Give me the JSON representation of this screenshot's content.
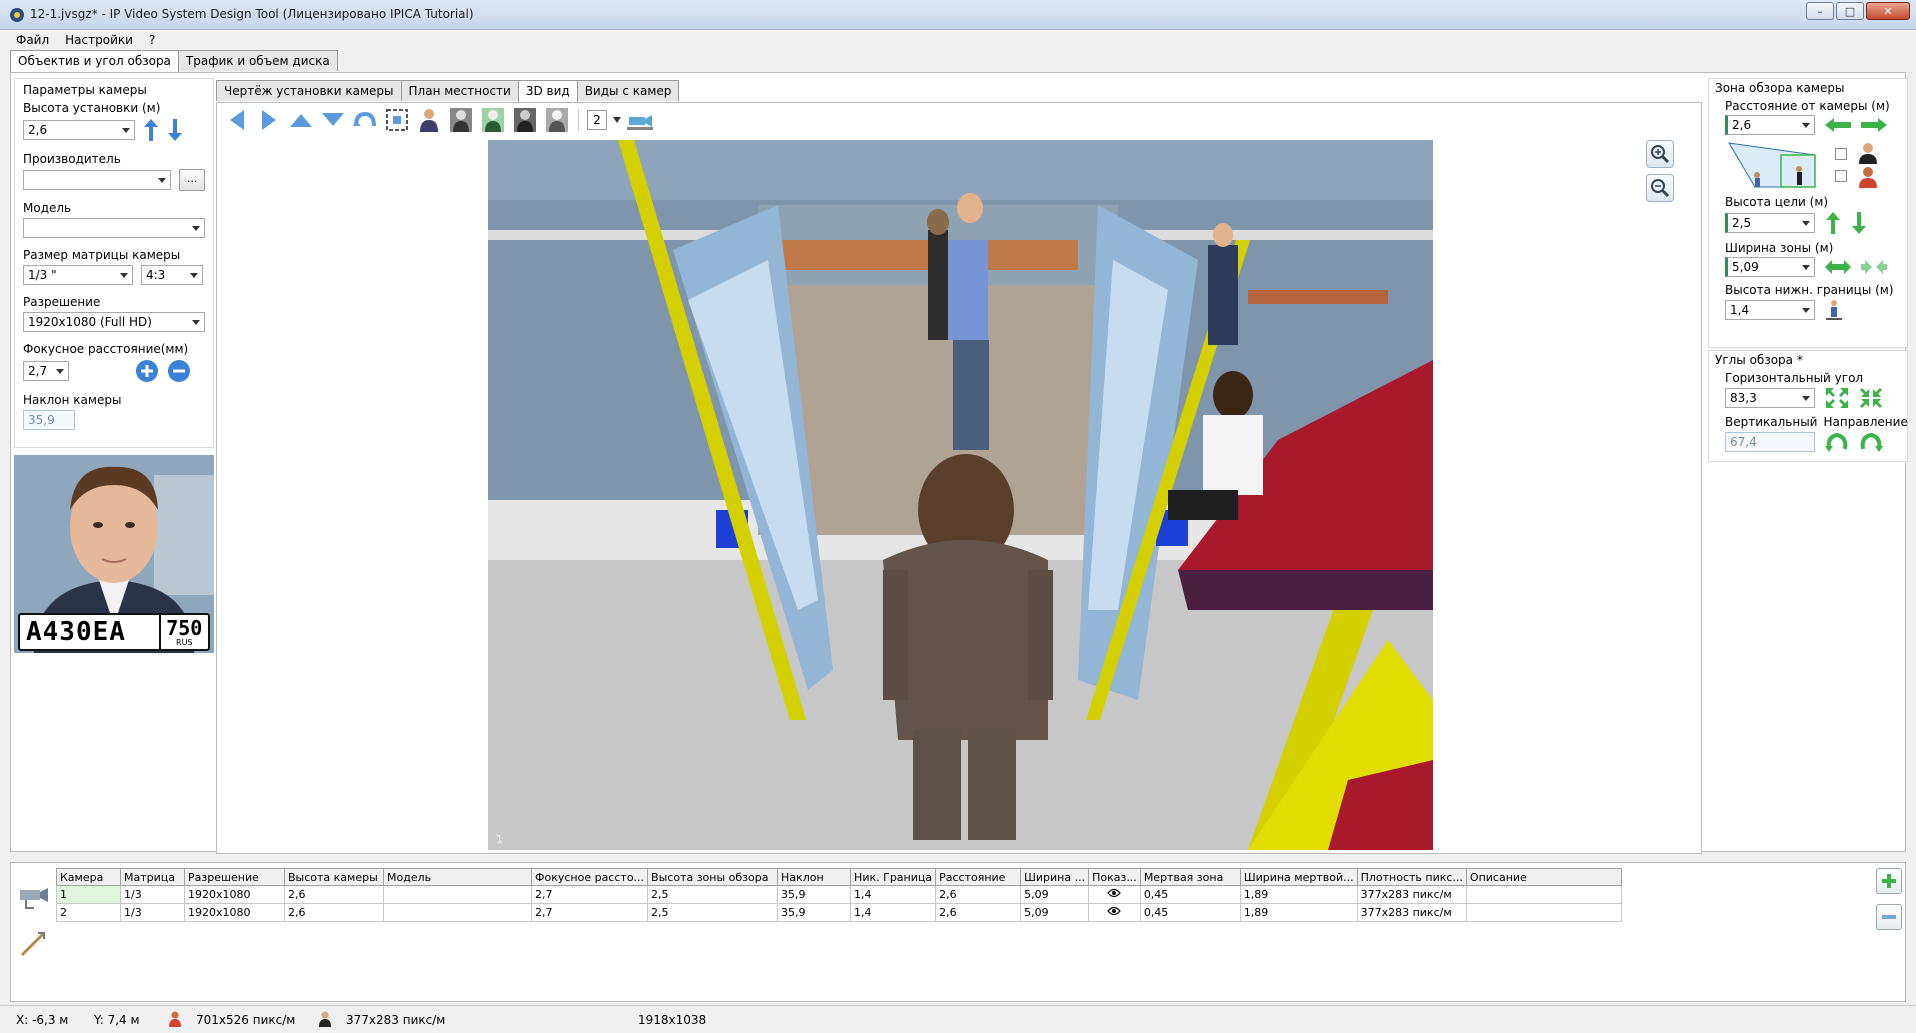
{
  "window": {
    "title": "12-1.jvsgz* - IP Video System Design Tool (Лицензировано  IPICA Tutorial)",
    "minimize": "–",
    "maximize": "□",
    "close": "✕"
  },
  "menu": [
    "Файл",
    "Настройки",
    "?"
  ],
  "main_tabs": [
    {
      "label": "Объектив и угол обзора",
      "active": true
    },
    {
      "label": "Трафик и объем диска",
      "active": false
    }
  ],
  "camera_params": {
    "group_title": "Параметры камеры",
    "mount_height_label": "Высота установки (м)",
    "mount_height_value": "2,6",
    "manufacturer_label": "Производитель",
    "manufacturer_value": "",
    "manufacturer_btn": "...",
    "model_label": "Модель",
    "model_value": "",
    "sensor_label": "Размер матрицы камеры",
    "sensor_value": "1/3 \"",
    "aspect_value": "4:3",
    "resolution_label": "Разрешение",
    "resolution_value": "1920x1080 (Full HD)",
    "focal_label": "Фокусное расстояние(мм)",
    "focal_value": "2,7",
    "tilt_label": "Наклон камеры",
    "tilt_value": "35,9"
  },
  "face_preview": {
    "plate_text": "A430EA",
    "plate_region": "750",
    "plate_country": "RUS"
  },
  "view_tabs": [
    {
      "label": "Чертёж установки камеры",
      "active": false
    },
    {
      "label": "План местности",
      "active": false
    },
    {
      "label": "3D вид",
      "active": true
    },
    {
      "label": "Виды с камер",
      "active": false
    }
  ],
  "toolbar": {
    "camera_number": "2"
  },
  "scene": {
    "camera_index": "1"
  },
  "view_zone": {
    "group_title": "Зона обзора камеры",
    "distance_label": "Расстояние от камеры (м)",
    "distance_value": "2,6",
    "target_height_label": "Высота цели (м)",
    "target_height_value": "2,5",
    "zone_width_label": "Ширина зоны (м)",
    "zone_width_value": "5,09",
    "lower_bound_label": "Высота нижн. границы (м)",
    "lower_bound_value": "1,4"
  },
  "angles": {
    "group_title": "Углы обзора *",
    "horizontal_label": "Горизонтальный угол",
    "horizontal_value": "83,3",
    "vertical_label": "Вертикальный",
    "vertical_value": "67,4",
    "direction_label": "Направление"
  },
  "table": {
    "columns": [
      "Камера",
      "Матрица",
      "Разрешение",
      "Высота камеры",
      "Модель",
      "Фокусное рассто...",
      "Высота зоны обзора",
      "Наклон",
      "Ник. Граница",
      "Расстояние",
      "Ширина ...",
      "Показ...",
      "Мертвая зона",
      "Ширина мертвой...",
      "Плотность пикс...",
      "Описание"
    ],
    "rows": [
      [
        "1",
        "1/3",
        "1920x1080",
        "2,6",
        "",
        "2,7",
        "2,5",
        "35,9",
        "1,4",
        "2,6",
        "5,09",
        "",
        "0,45",
        "1,89",
        "377x283 пикс/м",
        ""
      ],
      [
        "2",
        "1/3",
        "1920x1080",
        "2,6",
        "",
        "2,7",
        "2,5",
        "35,9",
        "1,4",
        "2,6",
        "5,09",
        "",
        "0,45",
        "1,89",
        "377x283 пикс/м",
        ""
      ]
    ]
  },
  "status": {
    "x": "X: -6,3 м",
    "y": "Y: 7,4 м",
    "density1": "701x526 пикс/м",
    "density2": "377x283 пикс/м",
    "resolution": "1918x1038"
  }
}
